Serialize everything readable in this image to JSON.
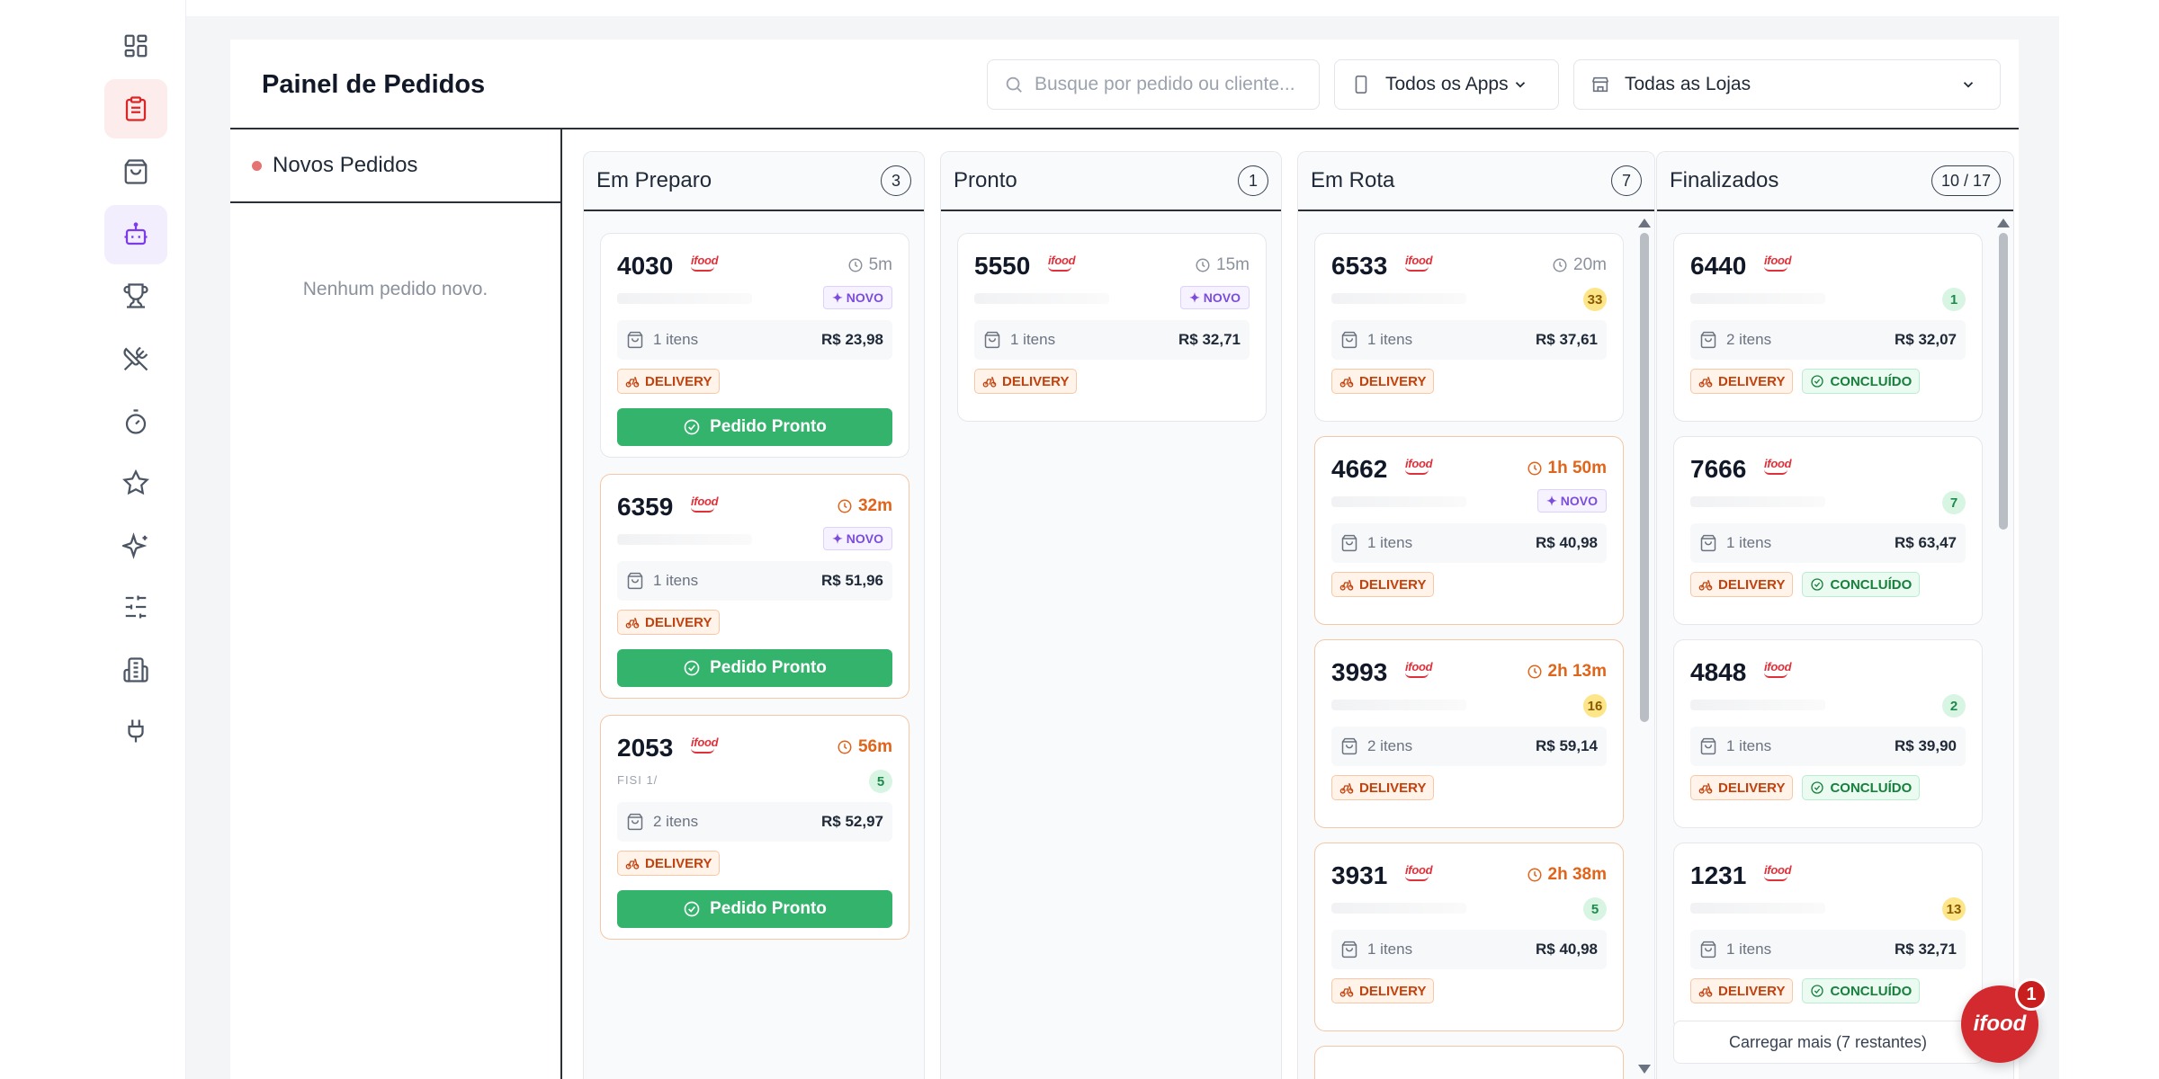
{
  "sidebar": {
    "items": [
      {
        "name": "dashboard-icon",
        "state": "default"
      },
      {
        "name": "clipboard-orders-icon",
        "state": "active-red"
      },
      {
        "name": "shopping-bag-icon",
        "state": "default"
      },
      {
        "name": "bot-icon",
        "state": "active-purple"
      },
      {
        "name": "trophy-icon",
        "state": "default"
      },
      {
        "name": "utensils-crossed-icon",
        "state": "default"
      },
      {
        "name": "timer-icon",
        "state": "default"
      },
      {
        "name": "star-icon",
        "state": "default"
      },
      {
        "name": "sparkles-icon",
        "state": "default"
      },
      {
        "name": "sliders-icon",
        "state": "default"
      },
      {
        "name": "building-icon",
        "state": "default"
      },
      {
        "name": "plug-icon",
        "state": "default"
      }
    ]
  },
  "header": {
    "title": "Painel de Pedidos",
    "search_placeholder": "Busque por pedido ou cliente...",
    "apps_filter": "Todos os Apps",
    "stores_filter": "Todas as Lojas"
  },
  "novos": {
    "title": "Novos Pedidos",
    "empty": "Nenhum pedido novo."
  },
  "labels": {
    "new_badge": "✦ NOVO",
    "delivery": "DELIVERY",
    "concluded": "CONCLUÍDO",
    "ready_button": "Pedido Pronto",
    "brand": "ifood"
  },
  "columns": {
    "preparo": {
      "title": "Em Preparo",
      "count": "3",
      "cards": [
        {
          "num": "4030",
          "time": "5m",
          "late": false,
          "customer": "",
          "badge": "new",
          "items": "1 itens",
          "price": "R$ 23,98",
          "concluded": false
        },
        {
          "num": "6359",
          "time": "32m",
          "late": true,
          "customer": "",
          "badge": "new",
          "items": "1 itens",
          "price": "R$ 51,96",
          "concluded": false
        },
        {
          "num": "2053",
          "time": "56m",
          "late": true,
          "customer": "FISI 1/ ",
          "badge": "5",
          "badge_color": "green",
          "items": "2 itens",
          "price": "R$ 52,97",
          "concluded": false
        }
      ]
    },
    "pronto": {
      "title": "Pronto",
      "count": "1",
      "cards": [
        {
          "num": "5550",
          "time": "15m",
          "late": false,
          "customer": "",
          "badge": "new",
          "items": "1 itens",
          "price": "R$ 32,71",
          "concluded": false
        }
      ]
    },
    "rota": {
      "title": "Em Rota",
      "count": "7",
      "cards": [
        {
          "num": "6533",
          "time": "20m",
          "late": false,
          "customer": "",
          "badge": "33",
          "badge_color": "yellow",
          "items": "1 itens",
          "price": "R$ 37,61",
          "concluded": false
        },
        {
          "num": "4662",
          "time": "1h 50m",
          "late": true,
          "customer": "",
          "badge": "new",
          "items": "1 itens",
          "price": "R$ 40,98",
          "concluded": false
        },
        {
          "num": "3993",
          "time": "2h 13m",
          "late": true,
          "customer": "",
          "badge": "16",
          "badge_color": "yellow",
          "items": "2 itens",
          "price": "R$ 59,14",
          "concluded": false
        },
        {
          "num": "3931",
          "time": "2h 38m",
          "late": true,
          "customer": "",
          "badge": "5",
          "badge_color": "green",
          "items": "1 itens",
          "price": "R$ 40,98",
          "concluded": false
        }
      ]
    },
    "final": {
      "title": "Finalizados",
      "count": "10 / 17",
      "cards": [
        {
          "num": "6440",
          "time": "",
          "late": false,
          "customer": "",
          "badge": "1",
          "badge_color": "green",
          "items": "2 itens",
          "price": "R$ 32,07",
          "concluded": true
        },
        {
          "num": "7666",
          "time": "",
          "late": false,
          "customer": "",
          "badge": "7",
          "badge_color": "green",
          "items": "1 itens",
          "price": "R$ 63,47",
          "concluded": true
        },
        {
          "num": "4848",
          "time": "",
          "late": false,
          "customer": "",
          "badge": "2",
          "badge_color": "green",
          "items": "1 itens",
          "price": "R$ 39,90",
          "concluded": true
        },
        {
          "num": "1231",
          "time": "",
          "late": false,
          "customer": "",
          "badge": "13",
          "badge_color": "yellow",
          "items": "1 itens",
          "price": "R$ 32,71",
          "concluded": true
        }
      ],
      "load_more": "Carregar mais (7 restantes)"
    }
  },
  "fab": {
    "brand": "ifood",
    "count": "1"
  },
  "colors": {
    "accent_green": "#33b36b",
    "delivery_orange": "#c2410c",
    "late_orange": "#e0641a",
    "brand_red": "#d32a2f",
    "new_purple": "#7c4ddb"
  }
}
